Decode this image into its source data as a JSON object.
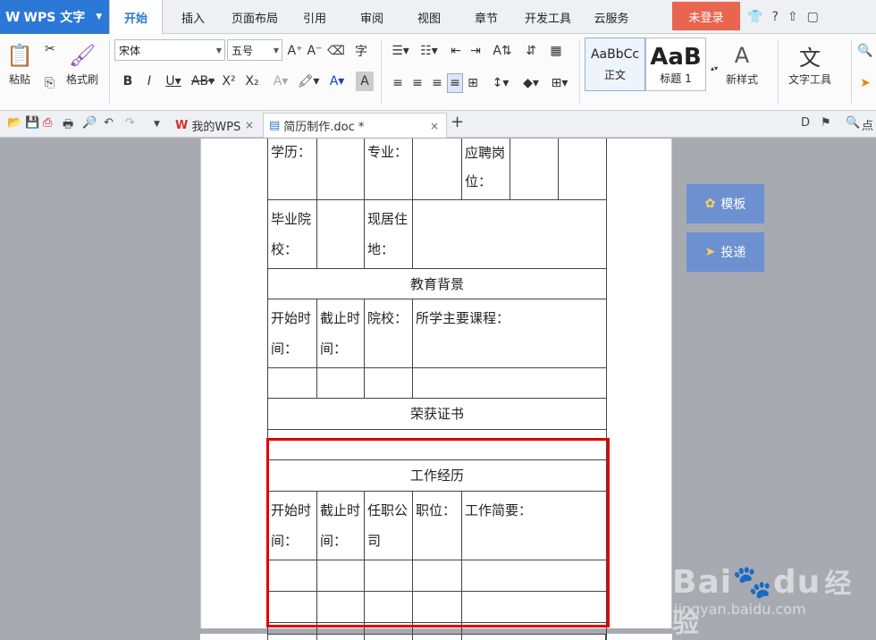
{
  "app": {
    "app_name": "WPS 文字",
    "tabs": [
      {
        "label": "开始",
        "active": true
      },
      {
        "label": "插入"
      },
      {
        "label": "页面布局"
      },
      {
        "label": "引用"
      },
      {
        "label": "审阅"
      },
      {
        "label": "视图"
      },
      {
        "label": "章节"
      },
      {
        "label": "开发工具"
      },
      {
        "label": "云服务"
      }
    ],
    "login_label": "未登录"
  },
  "ribbon": {
    "paste_label": "粘贴",
    "format_painter_label": "格式刷",
    "font_name": "宋体",
    "font_size": "五号",
    "style_normal_preview": "AaBbCc",
    "style_normal_label": "正文",
    "style_heading_preview": "AaB",
    "style_heading_label": "标题 1",
    "new_style_label": "新样式",
    "text_tools_label": "文字工具"
  },
  "docbar": {
    "tabs": [
      {
        "label": "我的WPS"
      },
      {
        "label": "简历制作.doc *",
        "active": true
      }
    ],
    "right_label": "点"
  },
  "document": {
    "row_edu_labels": [
      "学历：",
      "专业：",
      "应聘岗位："
    ],
    "row_school_labels": [
      "毕业院校：",
      "现居住地："
    ],
    "education_header": "教育背景",
    "education_columns": [
      "开始时间：",
      "截止时间：",
      "院校：",
      "所学主要课程："
    ],
    "certificates_header": "荣获证书",
    "work_header": "工作经历",
    "work_columns": [
      "开始时间：",
      "截止时间：",
      "任职公司",
      "职位：",
      "工作简要："
    ]
  },
  "side_buttons": {
    "template_label": "模板",
    "submit_label": "投递"
  },
  "watermark": {
    "brand": "Bai",
    "brand2": "du",
    "suffix": "经验",
    "url": "jingyan.baidu.com"
  },
  "colors": {
    "app_blue": "#2c78d6",
    "login_red": "#e8664f",
    "highlight_red": "#e00000",
    "side_button": "#6d90d1"
  }
}
